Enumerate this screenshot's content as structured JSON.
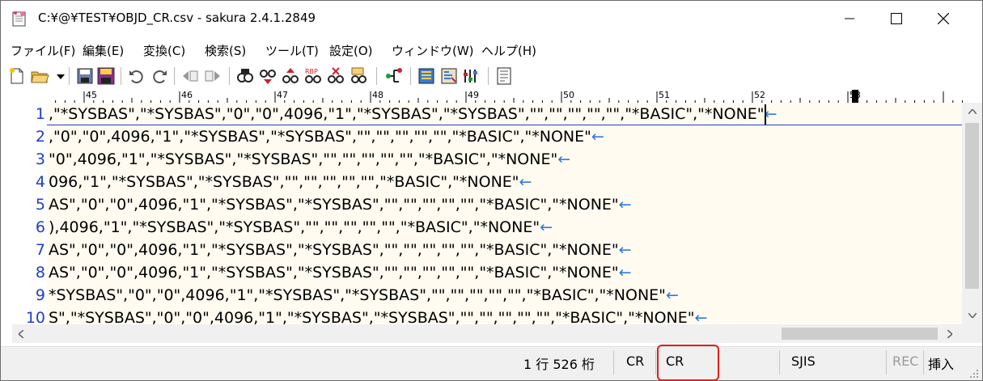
{
  "window": {
    "title": "C:¥@¥TEST¥OBJD_CR.csv - sakura 2.4.1.2849",
    "controls": [
      "minimize-icon",
      "maximize-icon",
      "close-icon"
    ]
  },
  "menu": [
    {
      "label": "ファイル(F)"
    },
    {
      "label": "編集(E)"
    },
    {
      "label": "変換(C)"
    },
    {
      "label": "検索(S)"
    },
    {
      "label": "ツール(T)"
    },
    {
      "label": "設定(O)"
    },
    {
      "label": "ウィンドウ(W)"
    },
    {
      "label": "ヘルプ(H)"
    }
  ],
  "toolbar": {
    "icons": [
      "new-file-icon",
      "open-folder-icon",
      "dropdown-arrow-icon",
      "save-icon",
      "save-all-icon",
      "undo-icon",
      "redo-icon",
      "jump-back-icon",
      "jump-forward-icon",
      "search-icon",
      "search-next-icon",
      "search-prev-icon",
      "replace-icon",
      "replace-all-icon",
      "grep-icon",
      "outline-icon",
      "compare-icon",
      "properties-icon",
      "setup-icon",
      "settings-icon"
    ]
  },
  "ruler": {
    "labels": [
      "45",
      "46",
      "47",
      "48",
      "49",
      "50",
      "51",
      "52",
      "53"
    ]
  },
  "editor": {
    "line_numbers": [
      "1",
      "2",
      "3",
      "4",
      "5",
      "6",
      "7",
      "8",
      "9",
      "10"
    ],
    "lines": [
      ",\"*SYSBAS\",\"*SYSBAS\",\"0\",\"0\",4096,\"1\",\"*SYSBAS\",\"*SYSBAS\",\"\",\"\",\"\",\"\",\"\",\"*BASIC\",\"*NONE\"",
      ",\"0\",\"0\",4096,\"1\",\"*SYSBAS\",\"*SYSBAS\",\"\",\"\",\"\",\"\",\"\",\"*BASIC\",\"*NONE\"",
      "\"0\",4096,\"1\",\"*SYSBAS\",\"*SYSBAS\",\"\",\"\",\"\",\"\",\"\",\"*BASIC\",\"*NONE\"",
      "096,\"1\",\"*SYSBAS\",\"*SYSBAS\",\"\",\"\",\"\",\"\",\"\",\"*BASIC\",\"*NONE\"",
      "AS\",\"0\",\"0\",4096,\"1\",\"*SYSBAS\",\"*SYSBAS\",\"\",\"\",\"\",\"\",\"\",\"*BASIC\",\"*NONE\"",
      "),4096,\"1\",\"*SYSBAS\",\"*SYSBAS\",\"\",\"\",\"\",\"\",\"\",\"*BASIC\",\"*NONE\"",
      "AS\",\"0\",\"0\",4096,\"1\",\"*SYSBAS\",\"*SYSBAS\",\"\",\"\",\"\",\"\",\"\",\"*BASIC\",\"*NONE\"",
      "AS\",\"0\",\"0\",4096,\"1\",\"*SYSBAS\",\"*SYSBAS\",\"\",\"\",\"\",\"\",\"\",\"*BASIC\",\"*NONE\"",
      "*SYSBAS\",\"0\",\"0\",4096,\"1\",\"*SYSBAS\",\"*SYSBAS\",\"\",\"\",\"\",\"\",\"\",\"*BASIC\",\"*NONE\"",
      "S\",\"*SYSBAS\",\"0\",\"0\",4096,\"1\",\"*SYSBAS\",\"*SYSBAS\",\"\",\"\",\"\",\"\",\"\",\"*BASIC\",\"*NONE\""
    ],
    "eol_mark": "←"
  },
  "statusbar": {
    "position": "1 行 526 桁",
    "eol_type": "CR",
    "eol_type2": "CR",
    "encoding": "SJIS",
    "rec": "REC",
    "insert_mode": "挿入"
  },
  "colors": {
    "line_number": "#1f3fc7",
    "eol_mark": "#2f7bd9",
    "text_bg": "#fffbf1",
    "highlight": "#e0201a"
  }
}
